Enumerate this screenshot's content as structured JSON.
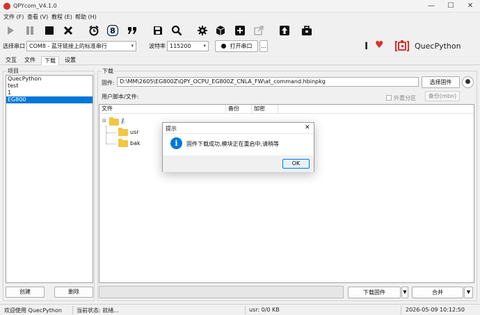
{
  "window": {
    "title": "QPYcom_V4.1.0",
    "controls": [
      "—",
      "☐",
      "✕"
    ]
  },
  "menu": [
    {
      "label": "文件 (F)"
    },
    {
      "label": "查看 (V)"
    },
    {
      "label": "教程 (E)"
    },
    {
      "label": "帮助 (H)"
    }
  ],
  "toolbar": {
    "icons": [
      "play-icon",
      "pause-icon",
      "stop-icon",
      "clear-icon",
      "alarm-icon",
      "digit-8-icon",
      "quote-icon",
      "save-icon",
      "search-icon",
      "settings-gear-icon",
      "package-cube-icon",
      "add-plus-icon",
      "export-icon",
      "upload-icon",
      "toolbox-icon"
    ]
  },
  "port": {
    "label": "选择串口",
    "value": "COM8 - 蓝牙链接上的标准串行",
    "baud_label": "波特率",
    "baud_value": "115200",
    "open_button": "打开串口",
    "more_button": "..."
  },
  "brand": {
    "name": "QuecPython",
    "accent": "#d9302b"
  },
  "tabs": [
    {
      "label": "交互",
      "active": false
    },
    {
      "label": "文件",
      "active": false
    },
    {
      "label": "下载",
      "active": true
    },
    {
      "label": "设置",
      "active": false
    }
  ],
  "projects": {
    "caption": "项目",
    "items": [
      {
        "label": "QuecPython",
        "selected": false
      },
      {
        "label": "test",
        "selected": false
      },
      {
        "label": "1",
        "selected": false
      },
      {
        "label": "EG800",
        "selected": true
      }
    ],
    "create_button": "创建",
    "delete_button": "删除"
  },
  "download": {
    "caption": "下载",
    "firmware_label": "固件:",
    "firmware_path": "D:\\MM\\2605\\EG800Z\\QPY_OCPU_EG800Z_CNLA_FW\\at_command.hbinpkg",
    "select_firmware_button": "选择固件",
    "scripts_label": "用户脚本/文件:",
    "external_partition": "外置分区",
    "backup_mbn": "备份(mbn)",
    "columns": [
      "文件",
      "备份",
      "加密"
    ],
    "tree": {
      "root": "/",
      "children": [
        "usr",
        "bak"
      ]
    },
    "download_firmware_button": "下载固件",
    "merge_button": "合并"
  },
  "status": {
    "welcome": "欢迎使用 QuecPython",
    "current_state": "当前状态: 就绪...",
    "usr": "usr: 0/0 KB",
    "datetime": "2026-05-09 10:12:50"
  },
  "dialog": {
    "title": "提示",
    "message": "固件下载成功,模块正在重启中,请稍等",
    "ok_button": "OK",
    "close": "✕"
  }
}
